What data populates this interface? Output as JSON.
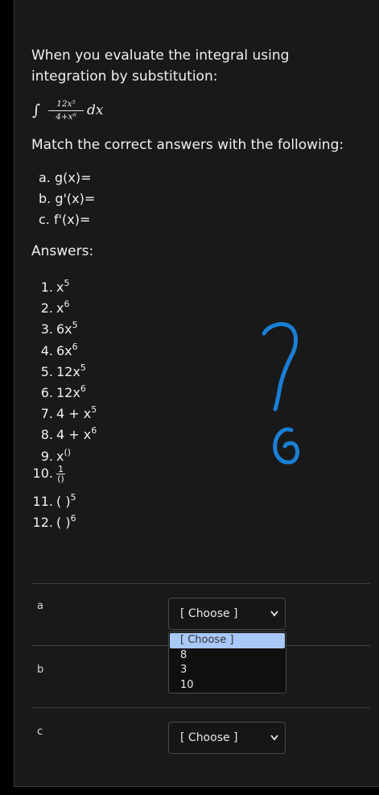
{
  "question": {
    "text": "When you evaluate the integral using integration by substitution:",
    "integral": {
      "sign": "∫",
      "numerator": "12x⁵",
      "denominator": "4+x⁶",
      "differential": "dx"
    },
    "match_prompt": "Match the correct answers with the following:",
    "sub_items": [
      "a. g(x)=",
      "b. g'(x)=",
      "c. f'(x)="
    ],
    "answers_title": "Answers:",
    "answers": [
      {
        "num": "1.",
        "base": "x",
        "sup": "5"
      },
      {
        "num": "2.",
        "base": "x",
        "sup": "6"
      },
      {
        "num": "3.",
        "base": "6x",
        "sup": "5"
      },
      {
        "num": "4.",
        "base": "6x",
        "sup": "6"
      },
      {
        "num": "5.",
        "base": "12x",
        "sup": "5"
      },
      {
        "num": "6.",
        "base": "12x",
        "sup": "6"
      },
      {
        "num": "7.",
        "base": "4 + x",
        "sup": "5"
      },
      {
        "num": "8.",
        "base": "4 + x",
        "sup": "6"
      },
      {
        "num": "9.",
        "base": "x",
        "sup": "()"
      },
      {
        "num": "10.",
        "frac_top": "1",
        "frac_bottom": "()"
      },
      {
        "num": "11.",
        "base": "( )",
        "sup": "5"
      },
      {
        "num": "12.",
        "base": "( )",
        "sup": "6"
      }
    ]
  },
  "annotation": {
    "color": "#1a7fd6",
    "description_icon": "question-mark-scribble"
  },
  "match_rows": [
    {
      "label": "a",
      "select_value": "[ Choose ]"
    },
    {
      "label": "b",
      "select_value": ""
    },
    {
      "label": "c",
      "select_value": "[ Choose ]"
    }
  ],
  "dropdown": {
    "options": [
      "[ Choose ]",
      "8",
      "3",
      "10"
    ],
    "highlight_color": "#a8c8f8"
  },
  "icons": {
    "chevron": "chevron-down-icon"
  }
}
